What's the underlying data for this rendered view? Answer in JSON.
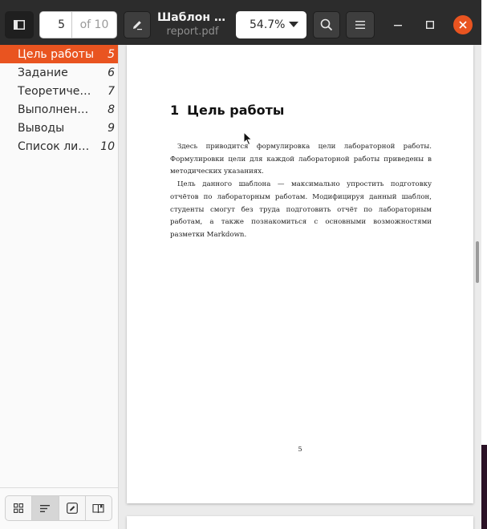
{
  "header": {
    "current_page": "5",
    "page_count_label": "of 10",
    "title": "Шаблон отчёта",
    "filename": "report.pdf",
    "zoom": "54.7%"
  },
  "outline": [
    {
      "label": "Цель работы",
      "page": "5",
      "active": true
    },
    {
      "label": "Задание",
      "page": "6"
    },
    {
      "label": "Теоретические сведения",
      "page": "7"
    },
    {
      "label": "Выполнение лабораторной работы",
      "page": "8"
    },
    {
      "label": "Выводы",
      "page": "9"
    },
    {
      "label": "Список литературы",
      "page": "10"
    }
  ],
  "sidebar_tabs": [
    {
      "icon": "thumbnails-icon"
    },
    {
      "icon": "outline-icon",
      "active": true
    },
    {
      "icon": "annotations-icon"
    },
    {
      "icon": "bookmarks-icon"
    }
  ],
  "document": {
    "section_number": "1",
    "section_title": "Цель работы",
    "paragraph_1": "Здесь приводится формулировка цели лабораторной работы. Формулировки цели для каждой лабораторной работы приведены в методических указаниях.",
    "paragraph_2": "Цель данного шаблона — максимально упростить подготовку отчётов по лабораторным работам. Модифицируя данный шаблон, студенты смогут без труда подготовить отчёт по лабораторным работам, а также познакомиться с основными возможностями разметки Markdown.",
    "page_footer": "5"
  },
  "colors": {
    "accent": "#e95420",
    "headerbar": "#2c2c2c"
  }
}
